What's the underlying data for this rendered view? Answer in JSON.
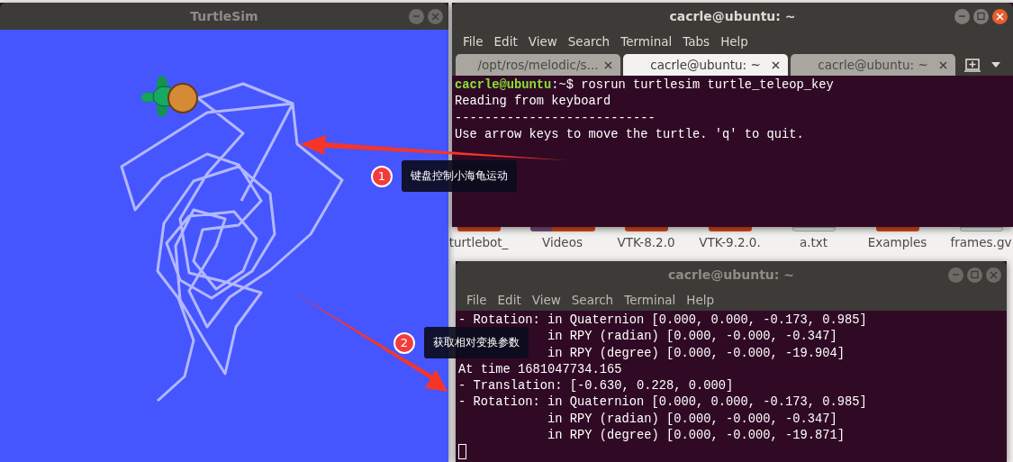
{
  "turtlesim": {
    "title": "TurtleSim",
    "active": false
  },
  "desktop_icons": [
    {
      "kind": "folder",
      "label": [
        "turtlebot_"
      ]
    },
    {
      "kind": "video-folder",
      "label": [
        "Videos"
      ]
    },
    {
      "kind": "folder",
      "label": [
        "VTK-8.2.0"
      ]
    },
    {
      "kind": "folder",
      "label": [
        "VTK-9.2.0."
      ]
    },
    {
      "kind": "file",
      "label": [
        "a.txt"
      ]
    },
    {
      "kind": "folder",
      "label": [
        "Examples"
      ]
    },
    {
      "kind": "file",
      "label": [
        "frames.gv"
      ]
    }
  ],
  "terminals": [
    {
      "title": "cacrle@ubuntu: ~",
      "active": true,
      "menu": [
        "File",
        "Edit",
        "View",
        "Search",
        "Terminal",
        "Tabs",
        "Help"
      ],
      "tabs": [
        {
          "label": "/opt/ros/melodic/s...",
          "selected": false
        },
        {
          "label": "cacrle@ubuntu: ~",
          "selected": true
        },
        {
          "label": "cacrle@ubuntu: ~",
          "selected": false
        }
      ],
      "lines": [
        {
          "kind": "prompt",
          "user": "cacrle@ubuntu",
          "path": ":~$",
          "text": " rosrun turtlesim turtle_teleop_key"
        },
        {
          "kind": "output",
          "text": "Reading from keyboard"
        },
        {
          "kind": "output",
          "text": "---------------------------"
        },
        {
          "kind": "output",
          "text": "Use arrow keys to move the turtle. 'q' to quit."
        }
      ]
    },
    {
      "title": "cacrle@ubuntu: ~",
      "active": false,
      "menu": [
        "File",
        "Edit",
        "View",
        "Search",
        "Terminal",
        "Help"
      ],
      "lines": [
        {
          "kind": "output",
          "text": "- Rotation: in Quaternion [0.000, 0.000, -0.173, 0.985]"
        },
        {
          "kind": "output",
          "text": "            in RPY (radian) [0.000, -0.000, -0.347]"
        },
        {
          "kind": "output",
          "text": "            in RPY (degree) [0.000, -0.000, -19.904]"
        },
        {
          "kind": "output",
          "text": "At time 1681047734.165"
        },
        {
          "kind": "output",
          "text": "- Translation: [-0.630, 0.228, 0.000]"
        },
        {
          "kind": "output",
          "text": "- Rotation: in Quaternion [0.000, 0.000, -0.173, 0.985]"
        },
        {
          "kind": "output",
          "text": "            in RPY (radian) [0.000, -0.000, -0.347]"
        },
        {
          "kind": "output",
          "text": "            in RPY (degree) [0.000, -0.000, -19.871]"
        },
        {
          "kind": "cursor"
        }
      ]
    }
  ],
  "annotations": [
    {
      "number": "1",
      "text": "键盘控制小海龟运动"
    },
    {
      "number": "2",
      "text": "获取相对变换参数"
    }
  ]
}
